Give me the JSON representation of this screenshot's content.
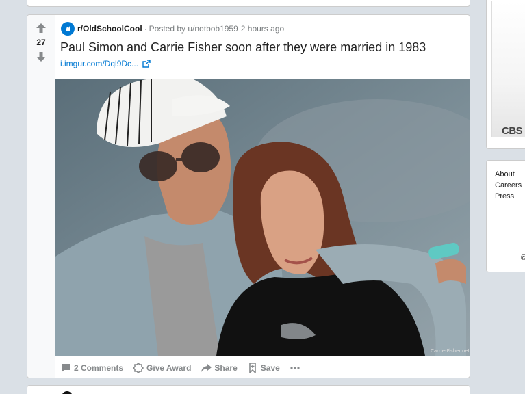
{
  "post": {
    "score": "27",
    "subreddit": "r/OldSchoolCool",
    "separator": "·",
    "posted_by": "Posted by u/notbob1959",
    "time": "2 hours ago",
    "title": "Paul Simon and Carrie Fisher soon after they were married in 1983",
    "link": "i.imgur.com/Dql9Dc...",
    "image_watermark": "Carrie-Fisher.net",
    "actions": {
      "comments": "2 Comments",
      "award": "Give Award",
      "share": "Share",
      "save": "Save"
    }
  },
  "sidebar": {
    "ad_brand": "CBS",
    "footer_links": [
      "About",
      "Careers",
      "Press"
    ],
    "copyright": "©"
  },
  "colors": {
    "accent": "#0079d3",
    "background": "#dae0e6",
    "muted": "#878a8c"
  },
  "icons": [
    "upvote-icon",
    "downvote-icon",
    "subreddit-icon",
    "external-link-icon",
    "comment-icon",
    "award-icon",
    "share-icon",
    "save-icon",
    "more-icon"
  ]
}
